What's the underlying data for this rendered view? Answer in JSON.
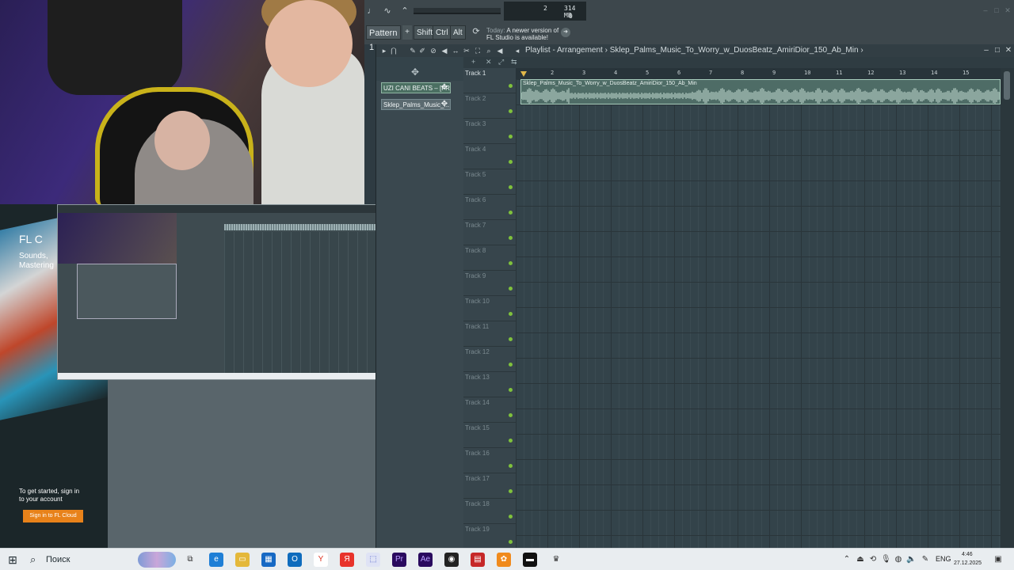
{
  "toolbar": {
    "cpu_value": "2",
    "memory": "314 MB",
    "polyphony": "0",
    "pattern_label": "Pattern 1",
    "shift_label": "Shift",
    "ctrl_label": "Ctrl",
    "alt_label": "Alt",
    "news_label": "Today:",
    "news_line1": "A newer version of",
    "news_line2": "FL Studio is available!"
  },
  "playlist": {
    "title": "Playlist - Arrangement › Sklep_Palms_Music_To_Worry_w_DuosBeatz_AmiriDior_150_Ab_Min ›",
    "picker_clips": [
      {
        "label": "UZI CANI BEATS – [FR..."
      },
      {
        "label": "Sklep_Palms_Music_..."
      }
    ],
    "tracks": [
      "Track 1",
      "Track 2",
      "Track 3",
      "Track 4",
      "Track 5",
      "Track 6",
      "Track 7",
      "Track 8",
      "Track 9",
      "Track 10",
      "Track 11",
      "Track 12",
      "Track 13",
      "Track 14",
      "Track 15",
      "Track 16",
      "Track 17",
      "Track 18",
      "Track 19"
    ],
    "bars": [
      "2",
      "3",
      "4",
      "5",
      "6",
      "7",
      "8",
      "9",
      "10",
      "11",
      "12",
      "13",
      "14",
      "15"
    ],
    "audio_clip_name": "Sklep_Palms_Music_To_Worry_w_DuosBeatz_AmiriDior_150_Ab_Min"
  },
  "cloud": {
    "brand": "FL C",
    "sub1": "Sounds,",
    "sub2": "Mastering",
    "msg1": "To get started, sign in",
    "msg2": "to your account",
    "signin_label": "Sign in to FL Cloud"
  },
  "taskbar": {
    "search_label": "Поиск",
    "lang": "ENG",
    "time": "4:46",
    "date": "27.12.2025"
  },
  "colors": {
    "accent_green": "#7fc13c",
    "clip_green": "#4e6c66",
    "cloud_orange": "#e8821a"
  }
}
